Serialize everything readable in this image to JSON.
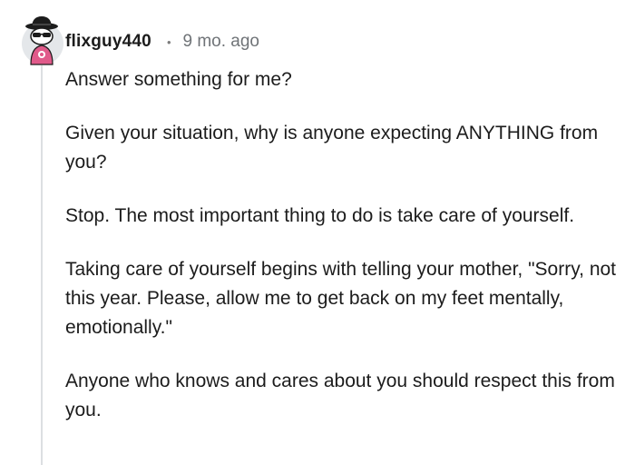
{
  "comment": {
    "username": "flixguy440",
    "separator": "•",
    "timestamp": "9 mo. ago",
    "paragraphs": [
      "Answer something for me?",
      "Given your situation, why is anyone expecting ANYTHING from you?",
      "Stop. The most important thing to do is take care of yourself.",
      "Taking care of yourself begins with telling your mother, \"Sorry, not this year. Please, allow me to get back on my feet mentally, emotionally.\"",
      "Anyone who knows and cares about you should respect this from you."
    ]
  },
  "colors": {
    "text": "#1c1c1c",
    "meta": "#6f7377",
    "thread_line": "#dcdfe2",
    "avatar_bg": "#e4e7ea",
    "avatar_shirt": "#e05a8a"
  },
  "icons": {
    "avatar": "snoo-avatar-icon"
  }
}
